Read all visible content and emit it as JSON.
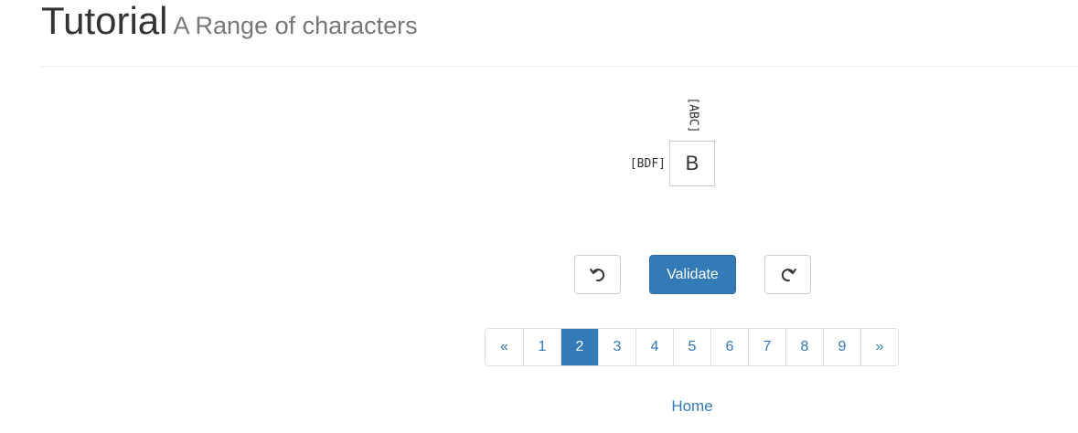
{
  "header": {
    "title": "Tutorial",
    "subtitle": "A Range of characters"
  },
  "puzzle": {
    "column_clue": "[ABC]",
    "row_clue": "[BDF]",
    "cell_value": "B"
  },
  "controls": {
    "undo_icon": "undo-icon",
    "validate_label": "Validate",
    "redo_icon": "redo-icon"
  },
  "pagination": {
    "prev_label": "«",
    "next_label": "»",
    "pages": [
      "1",
      "2",
      "3",
      "4",
      "5",
      "6",
      "7",
      "8",
      "9"
    ],
    "active_page": "2"
  },
  "footer": {
    "home_label": "Home"
  },
  "colors": {
    "primary": "#337ab7",
    "text": "#333333",
    "muted": "#777777",
    "border": "#dddddd"
  }
}
